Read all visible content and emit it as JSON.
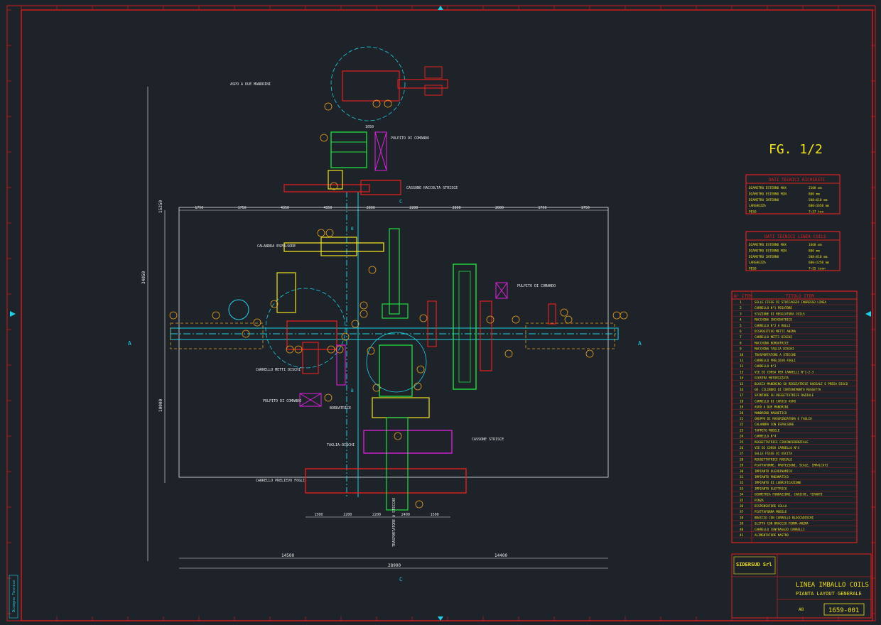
{
  "colors": {
    "background": "#1e2329",
    "frame": "#d01a1a",
    "cyan": "#20d0e8",
    "white": "#e8e8e8",
    "yellow": "#f0e020",
    "red": "#e02020",
    "green": "#20e040",
    "magenta": "#e020e0",
    "orange": "#e8a020"
  },
  "fig_label": "FG. 1/2",
  "side_stamp": "Disegno Tecnico",
  "table_dati_richiesti": {
    "title": "DATI TECNICI RICHIESTI",
    "rows": [
      [
        "DIAMETRO ESTERNO MAX",
        "2100 mm"
      ],
      [
        "DIAMETRO ESTERNO MIN",
        "800 mm"
      ],
      [
        "DIAMETRO INTERNO",
        "508÷610 mm"
      ],
      [
        "LARGHEZZA",
        "600÷1650 mm"
      ],
      [
        "PESO",
        "7÷37 ton"
      ]
    ]
  },
  "table_dati_linea": {
    "title": "DATI TECNICI LINEA COILS",
    "rows": [
      [
        "DIAMETRO ESTERNO MAX",
        "1660 mm"
      ],
      [
        "DIAMETRO ESTERNO MIN",
        "800 mm"
      ],
      [
        "DIAMETRO INTERNO",
        "508÷610 mm"
      ],
      [
        "LARGHEZZA",
        "600÷1250 mm"
      ],
      [
        "PESO",
        "7÷25 tonn"
      ]
    ]
  },
  "items_table": {
    "col_num": "N° ITEM",
    "col_title": "TITOLO ITEM",
    "rows": [
      [
        "1",
        "SELLE FISSE DI STOCCAGGIO INGRESSO LINEA"
      ],
      [
        "2",
        "CARRELLO N°1 PESATORE"
      ],
      [
        "3",
        "STAZIONE DI REGGIATURA COILS"
      ],
      [
        "4",
        "MACCHINA INCHINATRICE"
      ],
      [
        "5",
        "CARRELLO N°2 A RULLI"
      ],
      [
        "6",
        "DISPOSITIVO METTI ANIMA"
      ],
      [
        "7",
        "CARRELLO METTI DISCHI"
      ],
      [
        "8",
        "MACCHINA BORDATRICE"
      ],
      [
        "9",
        "MACCHINA TAGLIA DISCHI"
      ],
      [
        "10",
        "TRASPORTATORE A STECCHE"
      ],
      [
        "11",
        "CARRELLO PRELIEVO FOGLI"
      ],
      [
        "12",
        "CARRELLO N°3"
      ],
      [
        "13",
        "VIE DI CORSA PER CARRELLI N°1-2-3"
      ],
      [
        "14",
        "GIOSTRA MOTORIZZATA"
      ],
      [
        "15",
        "BLOCCA MANDRINO SU REGGIATRICE RADIALE E PRESA DISCO"
      ],
      [
        "16",
        "GR. CILINDRI DI CONTENIMENTO REGGETTA"
      ],
      [
        "17",
        "SPINTORE SU REGGETTATRICE RADIALE"
      ],
      [
        "18",
        "CARRELLO DI CARICO ASPO"
      ],
      [
        "19",
        "ASPO A DUE MANDRINI"
      ],
      [
        "20",
        "MANDRINO MAGNETICO"
      ],
      [
        "21",
        "GRUPPO DI RAGGRINZATURA E TAGLIO"
      ],
      [
        "22",
        "CALANDRA CON ESPULSORE"
      ],
      [
        "23",
        "TAPPETO MOBILE"
      ],
      [
        "24",
        "CARRELLO N°4"
      ],
      [
        "25",
        "REGGETTATRICE CIRCONFERENZIALE"
      ],
      [
        "26",
        "VIE DI CORSA CARRELLO N°4"
      ],
      [
        "27",
        "SELLE FISSE DI USCITA"
      ],
      [
        "28",
        "REGGETTATRICE RADIALE"
      ],
      [
        "29",
        "PIATTAFORME, PROTEZIONI, SCALE, IMPALCATI"
      ],
      [
        "30",
        "IMPIANTO OLEODINAMICO"
      ],
      [
        "31",
        "IMPIANTO PNEUMATICO"
      ],
      [
        "32",
        "IMPIANTO DI LUBRIFICAZIONE"
      ],
      [
        "33",
        "IMPIANTO ELETTRICO"
      ],
      [
        "34",
        "GEOMETRIA FONDAZIONI, CARICHI, TIRANTI"
      ],
      [
        "35",
        "PINZA"
      ],
      [
        "36",
        "DISPENSATORE COLLA"
      ],
      [
        "37",
        "PIATTAFORMA MOBILE"
      ],
      [
        "38",
        "BRACCIO CON CARRELLO BLOCCADISCHI"
      ],
      [
        "39",
        "SLITTA CON BRACCIO FERMA-ANIMA"
      ],
      [
        "40",
        "CARRELLO CENTRAGGIO CARRELLI"
      ],
      [
        "41",
        "ALIMENTATORE NASTRO"
      ]
    ]
  },
  "title_block": {
    "company": "SIDERSUD Srl",
    "drawing_title": "LINEA IMBALLO COILS",
    "drawing_subtitle": "PIANTA LAYOUT GENERALE",
    "format": "A0",
    "drawing_number": "1659-001"
  },
  "labels": {
    "aspo": "ASPO A DUE MANDRINI",
    "pulpito_comando_1": "PULPITO DI COMANDO",
    "cassone": "CASSONE RACCOLTA STRISCE",
    "calandra": "CALANDRA ESPULSORE",
    "carrello_metti_dischi": "CARRELLO METTI DISCHI",
    "pulpito_comando_2": "PULPITO DI COMANDO",
    "pulpito_comando_3": "PULPITO DI COMANDO",
    "bordatrice": "BORDATRICE",
    "taglia_dischi": "TAGLIA-DISCHI",
    "cassone_2": "CASSONE STRISCE",
    "carrello_prelievo": "CARRELLO PRELIEVO FOGLI",
    "trasportatore": "TRASPORTATORE A STECCHE",
    "section_a": "A",
    "section_c": "C",
    "section_b": "B"
  },
  "dimensions": {
    "top_row": [
      "1750",
      "1750",
      "4350",
      "4350",
      "2800",
      "2200",
      "2800",
      "2000",
      "1750",
      "1750"
    ],
    "bottom_row": [
      "1500",
      "2200",
      "2200",
      "2400",
      "1500"
    ],
    "left_total_1": "34050",
    "left_total_2": "10000",
    "left_upper": "15250",
    "overall_left": "14500",
    "overall_right": "14400",
    "overall_total": "28900",
    "dim_1050": "1050"
  }
}
